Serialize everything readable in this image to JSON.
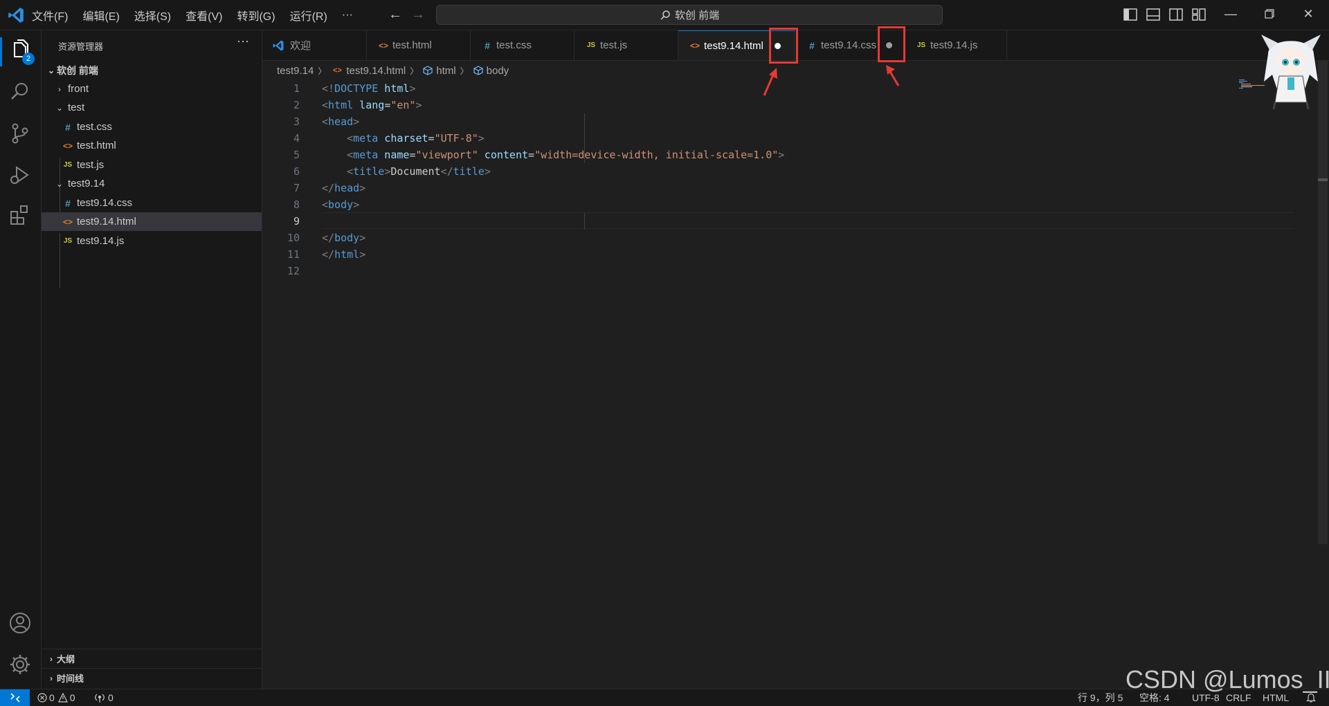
{
  "menu": [
    "文件(F)",
    "编辑(E)",
    "选择(S)",
    "查看(V)",
    "转到(G)",
    "运行(R)",
    "···"
  ],
  "search": {
    "text": "软创 前端"
  },
  "activity": {
    "explorer_badge": "2"
  },
  "sidebar": {
    "title": "资源管理器",
    "more": "···",
    "root": "软创 前端",
    "items": [
      {
        "label": "front",
        "kind": "folder-collapsed"
      },
      {
        "label": "test",
        "kind": "folder-open"
      },
      {
        "label": "test.css",
        "kind": "css"
      },
      {
        "label": "test.html",
        "kind": "html"
      },
      {
        "label": "test.js",
        "kind": "js"
      },
      {
        "label": "test9.14",
        "kind": "folder-open"
      },
      {
        "label": "test9.14.css",
        "kind": "css"
      },
      {
        "label": "test9.14.html",
        "kind": "html",
        "selected": true
      },
      {
        "label": "test9.14.js",
        "kind": "js"
      }
    ],
    "outline": "大纲",
    "timeline": "时间线"
  },
  "tabs": [
    {
      "label": "欢迎",
      "icon": "vscode-icon"
    },
    {
      "label": "test.html",
      "icon": "html-icon"
    },
    {
      "label": "test.css",
      "icon": "css-icon"
    },
    {
      "label": "test.js",
      "icon": "js-icon"
    },
    {
      "label": "test9.14.html",
      "icon": "html-icon",
      "active": true,
      "dirty": true
    },
    {
      "label": "test9.14.css",
      "icon": "css-icon",
      "dirty": true
    },
    {
      "label": "test9.14.js",
      "icon": "js-icon"
    }
  ],
  "icon_text": {
    "css": "#",
    "html": "<>",
    "js": "JS"
  },
  "breadcrumb": [
    "test9.14",
    "test9.14.html",
    "html",
    "body"
  ],
  "editor": {
    "current_line": 9,
    "line_numbers": [
      "1",
      "2",
      "3",
      "4",
      "5",
      "6",
      "7",
      "8",
      "9",
      "10",
      "11",
      "12"
    ]
  },
  "status": {
    "remote_icon": "remote-icon",
    "errors": "0",
    "warnings": "0",
    "ports": "0",
    "position": "行 9，列 5",
    "spaces": "空格: 4",
    "encoding": "UTF-8",
    "eol": "CRLF",
    "language": "HTML"
  },
  "watermark": "CSDN @Lumos_II",
  "colors": {
    "accent": "#0078d4",
    "annotation": "#e53935"
  }
}
